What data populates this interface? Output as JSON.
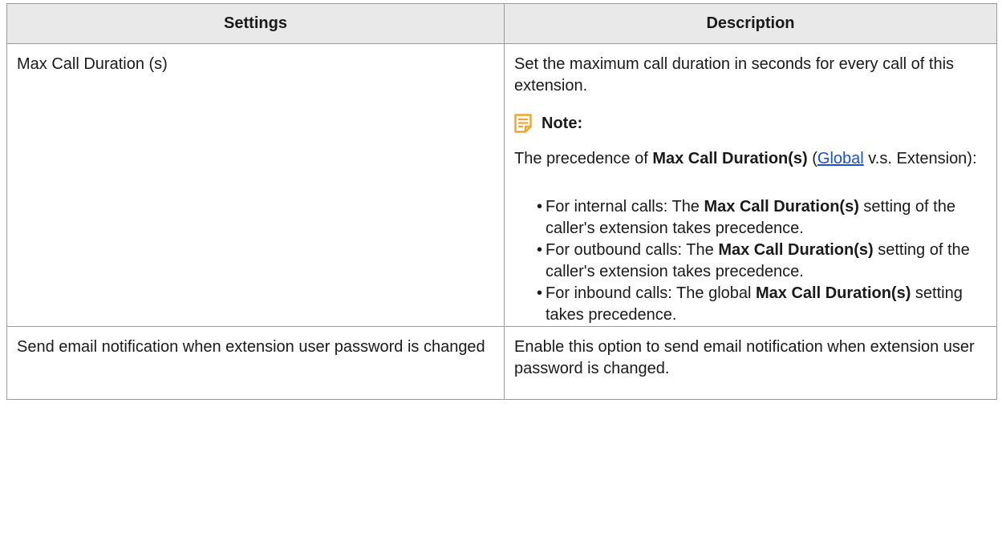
{
  "table": {
    "headers": [
      "Settings",
      "Description"
    ],
    "rows": [
      {
        "setting": "Max Call Duration (s)",
        "description": "Set the maximum call duration in seconds for every call of this extension.",
        "note_title": "Note:",
        "note_icon": "note-icon",
        "precedence": {
          "prefix": "The precedence of ",
          "term": "Max Call Duration(s)",
          "open_paren": " (",
          "link": "Global",
          "suffix": " v.s. Extension):"
        },
        "bullets": [
          {
            "before": "For internal calls: The ",
            "bold": "Max Call Duration(s)",
            "after": " setting of the caller's extension takes precedence."
          },
          {
            "before": "For outbound calls: The ",
            "bold": "Max Call Duration(s)",
            "after": " setting of the caller's extension takes precedence."
          },
          {
            "before": "For inbound calls: The global ",
            "bold": "Max Call Duration(s)",
            "after": " setting takes precedence."
          }
        ]
      },
      {
        "setting": "Send email notification when extension user password is changed",
        "description": "Enable this option to send email notification when extension user password is changed."
      }
    ]
  },
  "colors": {
    "header_bg": "#e9e9e9",
    "border": "#9a9a9a",
    "link": "#1a4fd6",
    "note_icon": "#f2a32c"
  }
}
